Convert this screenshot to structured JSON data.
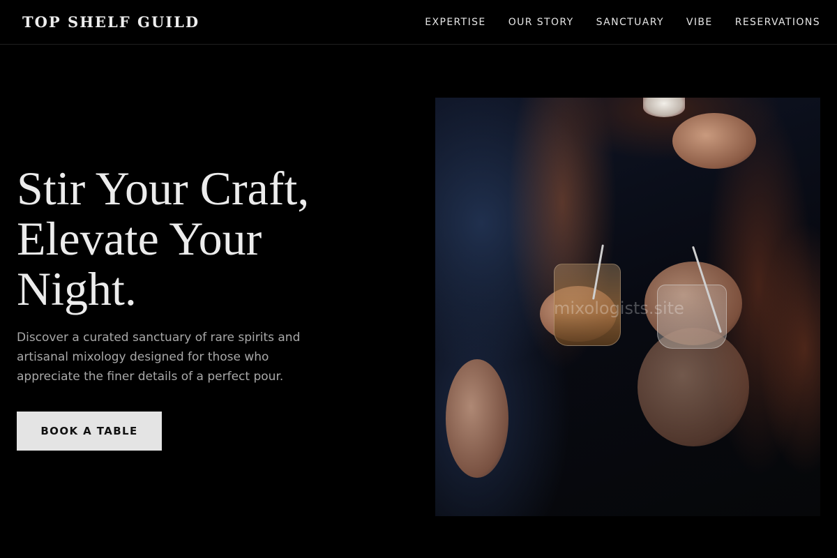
{
  "header": {
    "brand": "TOP SHELF GUILD",
    "nav": [
      {
        "label": "EXPERTISE"
      },
      {
        "label": "OUR STORY"
      },
      {
        "label": "SANCTUARY"
      },
      {
        "label": "VIBE"
      },
      {
        "label": "RESERVATIONS"
      }
    ]
  },
  "hero": {
    "heading_lines": [
      "Stir Your Craft,",
      "Elevate Your",
      "Night."
    ],
    "subtitle": "Discover a curated sanctuary of rare spirits and artisanal mixology designed for those who appreciate the finer details of a perfect pour.",
    "cta_label": "BOOK A TABLE",
    "image": {
      "subject": "people laughing and toasting with cocktails",
      "watermark": "mixologists.site"
    }
  },
  "colors": {
    "background": "#000000",
    "text": "#ececec",
    "muted_text": "#a9a9a9",
    "button_bg": "#e4e4e4",
    "button_text": "#111111"
  }
}
